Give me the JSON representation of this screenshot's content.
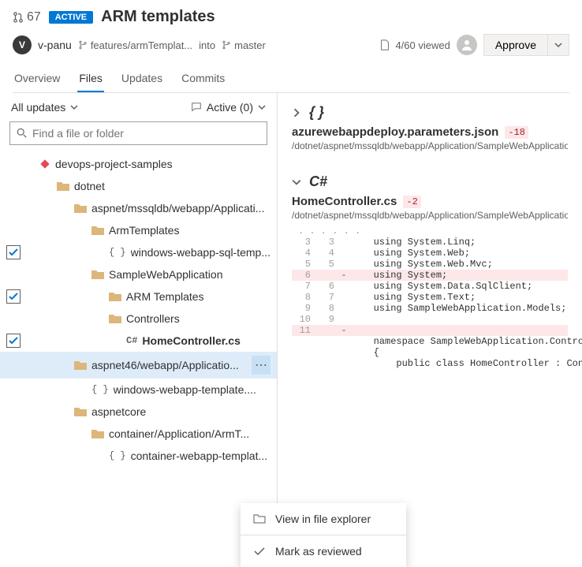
{
  "header": {
    "pr_number": "67",
    "badge": "ACTIVE",
    "title": "ARM templates",
    "avatar_initial": "V",
    "username": "v-panu",
    "source_branch": "features/armTemplat...",
    "into_label": "into",
    "target_branch": "master",
    "viewed": "4/60 viewed",
    "approve_label": "Approve"
  },
  "tabs": [
    "Overview",
    "Files",
    "Updates",
    "Commits"
  ],
  "left": {
    "filter_left": "All updates",
    "filter_right": "Active (0)",
    "search_placeholder": "Find a file or folder",
    "tree": [
      {
        "type": "root",
        "label": "devops-project-samples",
        "indent": 0
      },
      {
        "type": "folder",
        "label": "dotnet",
        "indent": 1
      },
      {
        "type": "folder",
        "label": "aspnet/mssqldb/webapp/Applicati...",
        "indent": 2
      },
      {
        "type": "folder",
        "label": "ArmTemplates",
        "indent": 3
      },
      {
        "type": "code",
        "label": "windows-webapp-sql-temp...",
        "indent": 4,
        "checked": true
      },
      {
        "type": "folder",
        "label": "SampleWebApplication",
        "indent": 3
      },
      {
        "type": "folder",
        "label": "ARM Templates",
        "indent": 4,
        "checked": true
      },
      {
        "type": "folder",
        "label": "Controllers",
        "indent": 4
      },
      {
        "type": "cs",
        "label": "HomeController.cs",
        "indent": 5,
        "checked": true,
        "bold": true
      },
      {
        "type": "folder",
        "label": "aspnet46/webapp/Applicatio...",
        "indent": 2,
        "selected": true,
        "more": true
      },
      {
        "type": "code",
        "label": "windows-webapp-template....",
        "indent": 3
      },
      {
        "type": "folder",
        "label": "aspnetcore",
        "indent": 2
      },
      {
        "type": "folder",
        "label": "container/Application/ArmT...",
        "indent": 3
      },
      {
        "type": "code",
        "label": "container-webapp-templat...",
        "indent": 4
      }
    ]
  },
  "context_menu": {
    "item1": "View in file explorer",
    "item2": "Mark as reviewed"
  },
  "files": [
    {
      "collapsed": true,
      "type_label": "{ }",
      "name": "azurewebappdeploy.parameters.json",
      "diff": "-18",
      "path": "/dotnet/aspnet/mssqldb/webapp/Application/SampleWebApplication"
    },
    {
      "collapsed": false,
      "type_label": "C#",
      "name": "HomeController.cs",
      "diff": "-2",
      "path": "/dotnet/aspnet/mssqldb/webapp/Application/SampleWebApplication",
      "lines": [
        {
          "old": "3",
          "new": "3",
          "text": "   using System.Linq;"
        },
        {
          "old": "4",
          "new": "4",
          "text": "   using System.Web;"
        },
        {
          "old": "5",
          "new": "5",
          "text": "   using System.Web.Mvc;"
        },
        {
          "old": "6",
          "new": "",
          "removed": true,
          "text": "   using System;"
        },
        {
          "old": "7",
          "new": "6",
          "text": "   using System.Data.SqlClient;"
        },
        {
          "old": "8",
          "new": "7",
          "text": "   using System.Text;"
        },
        {
          "old": "9",
          "new": "8",
          "text": "   using SampleWebApplication.Models;"
        },
        {
          "old": "10",
          "new": "9",
          "text": ""
        },
        {
          "old": "11",
          "new": "",
          "removed": true,
          "text": ""
        },
        {
          "old": "",
          "new": "",
          "text": "   namespace SampleWebApplication.Controllers"
        },
        {
          "old": "",
          "new": "",
          "text": "   {"
        },
        {
          "old": "",
          "new": "",
          "text": "       public class HomeController : Controller"
        }
      ]
    }
  ]
}
